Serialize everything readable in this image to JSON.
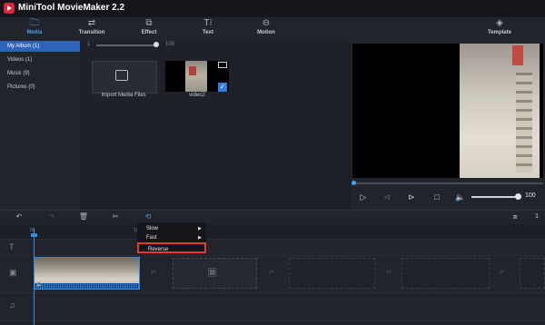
{
  "app": {
    "title": "MiniTool MovieMaker 2.2"
  },
  "toolbar": {
    "tabs": [
      {
        "label": "Media",
        "icon": "folder-icon"
      },
      {
        "label": "Transition",
        "icon": "transition-icon"
      },
      {
        "label": "Effect",
        "icon": "effect-icon"
      },
      {
        "label": "Text",
        "icon": "text-icon"
      },
      {
        "label": "Motion",
        "icon": "motion-icon"
      },
      {
        "label": "Template",
        "icon": "template-icon"
      }
    ],
    "active_tab": "Media",
    "icon_glyphs": [
      "🗀",
      "⇄",
      "⧉",
      "T⁝",
      "⊖",
      "◈"
    ]
  },
  "sidebar": {
    "items": [
      {
        "label": "My Album  (1)"
      },
      {
        "label": "Videos  (1)"
      },
      {
        "label": "Music  (9)"
      },
      {
        "label": "Pictures  (0)"
      }
    ]
  },
  "media": {
    "zoom_min": "1",
    "zoom_max": "100",
    "zoom_level": 1.0,
    "import_label": "Import Media Files",
    "video_name": "video2"
  },
  "player": {
    "volume_value": "100",
    "progress": 0.0,
    "volume": 1.0
  },
  "timeline_toolbar": {
    "glyphs": [
      "↶",
      "↷",
      "🗑",
      "✂",
      "⟲",
      "⧈"
    ],
    "track_count": "1"
  },
  "timeline": {
    "ruler_labels": [
      "0s",
      "10"
    ],
    "track_icons": [
      "T",
      "▣",
      "♫"
    ]
  },
  "context_menu": {
    "items": [
      {
        "label": "Slow",
        "has_submenu": true
      },
      {
        "label": "Fast",
        "has_submenu": true
      },
      {
        "label": "Reverse",
        "has_submenu": false
      }
    ],
    "highlighted": "Reverse",
    "highlight_color": "#e33a33"
  },
  "colors": {
    "accent": "#2f8fe8",
    "brand": "#e0243b",
    "selected": "#2d63b8"
  }
}
